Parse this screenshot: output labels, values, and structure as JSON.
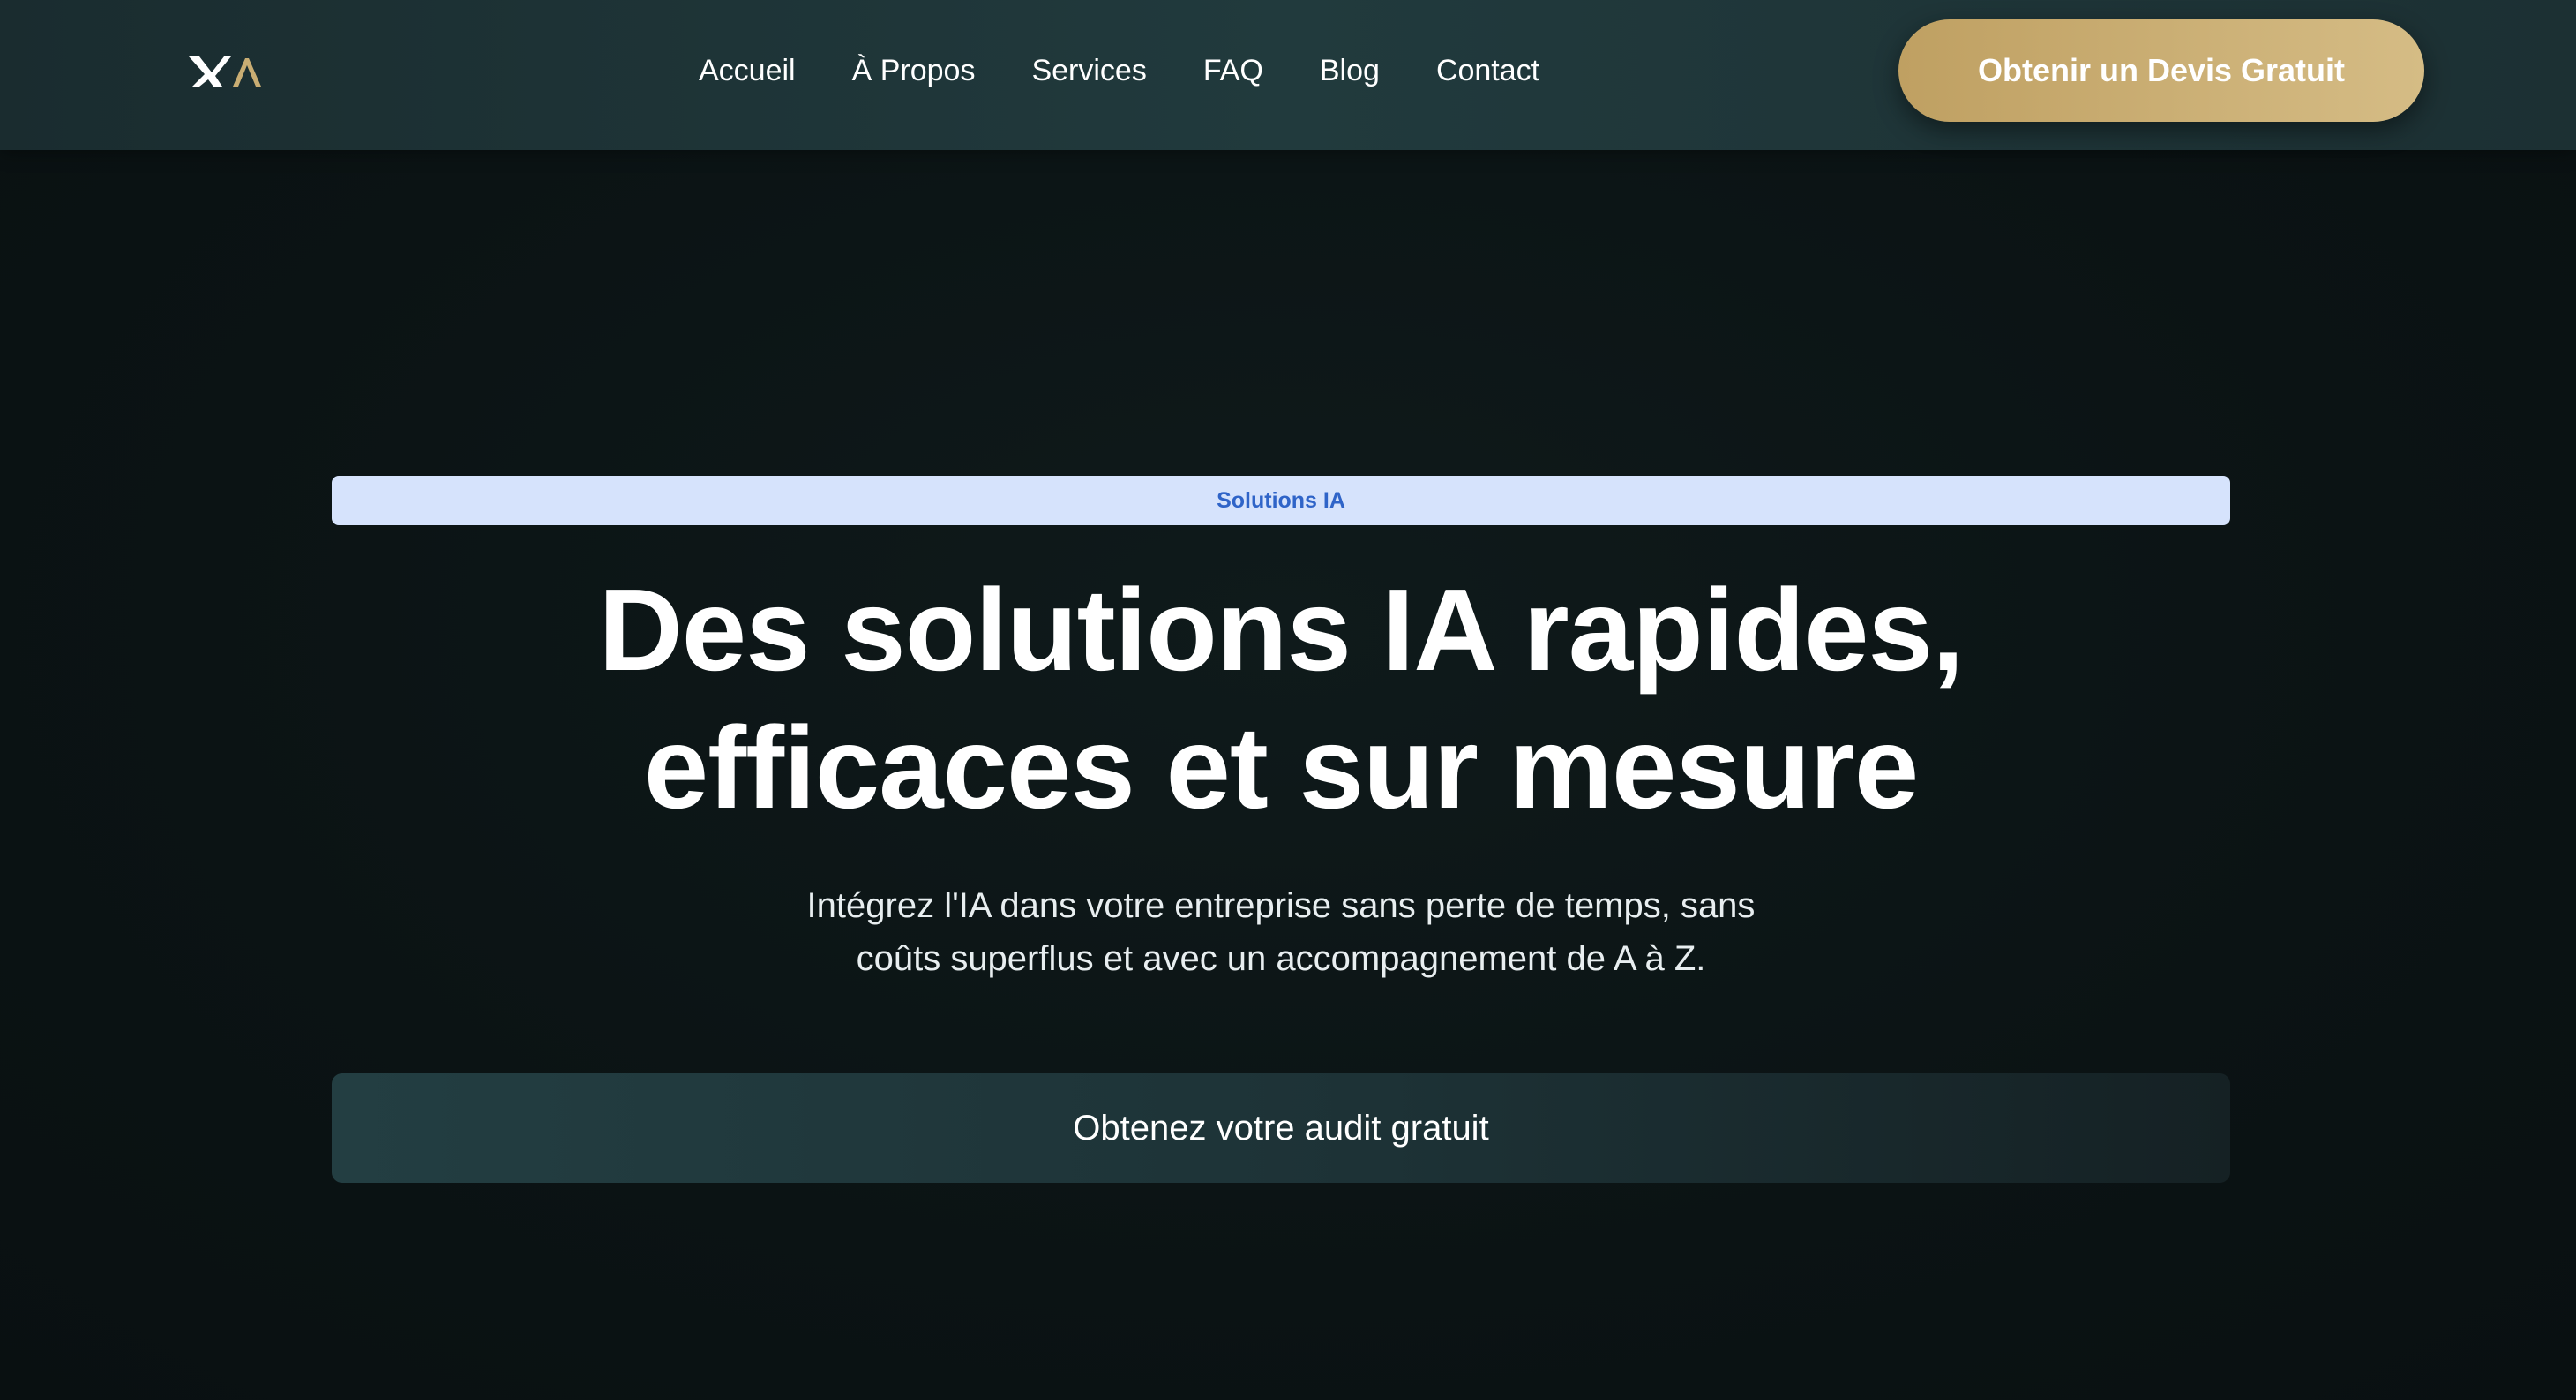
{
  "header": {
    "logo_icon": "xa-monogram-logo",
    "nav": [
      {
        "label": "Accueil"
      },
      {
        "label": "À Propos"
      },
      {
        "label": "Services"
      },
      {
        "label": "FAQ"
      },
      {
        "label": "Blog"
      },
      {
        "label": "Contact"
      }
    ],
    "cta_label": "Obtenir un Devis Gratuit"
  },
  "hero": {
    "badge": "Solutions IA",
    "title_lines": [
      "Des solutions IA rapides,",
      "efficaces et sur mesure"
    ],
    "subtitle_lines": [
      "Intégrez l'IA dans votre entreprise sans perte de temps, sans",
      "coûts superflus et avec un accompagnement de A à Z."
    ],
    "cta_label": "Obtenez votre audit gratuit"
  },
  "colors": {
    "background": "#0c1415",
    "header_bg": "#213a3d",
    "gold_accent": "#c9ad73",
    "badge_bg": "#d6e3fc",
    "badge_text": "#2f64c8",
    "cta_bg": "#233e42"
  }
}
